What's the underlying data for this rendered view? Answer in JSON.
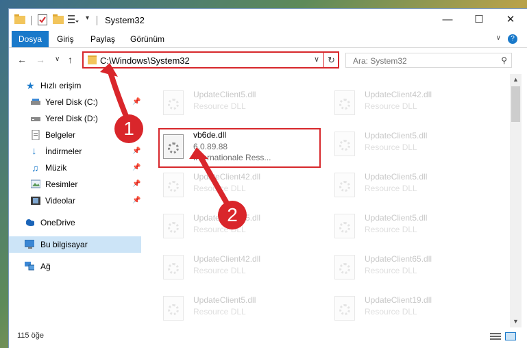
{
  "window": {
    "title": "System32"
  },
  "ribbon": {
    "tabs": [
      {
        "label": "Dosya",
        "active": true
      },
      {
        "label": "Giriş",
        "active": false
      },
      {
        "label": "Paylaş",
        "active": false
      },
      {
        "label": "Görünüm",
        "active": false
      }
    ],
    "help": "?"
  },
  "navigation": {
    "path": "C:\\Windows\\System32",
    "search_placeholder": "Ara: System32"
  },
  "sidebar": {
    "items": [
      {
        "label": "Hızlı erişim",
        "icon": "star-icon"
      },
      {
        "label": "Yerel Disk (C:)",
        "icon": "drive-icon",
        "pinned": true
      },
      {
        "label": "Yerel Disk (D:)",
        "icon": "drive-icon"
      },
      {
        "label": "Belgeler",
        "icon": "document-icon",
        "pinned": true
      },
      {
        "label": "İndirmeler",
        "icon": "download-icon",
        "pinned": true
      },
      {
        "label": "Müzik",
        "icon": "music-icon",
        "pinned": true
      },
      {
        "label": "Resimler",
        "icon": "pictures-icon",
        "pinned": true
      },
      {
        "label": "Videolar",
        "icon": "video-icon",
        "pinned": true
      },
      {
        "label": "OneDrive",
        "icon": "cloud-icon"
      },
      {
        "label": "Bu bilgisayar",
        "icon": "computer-icon",
        "selected": true
      },
      {
        "label": "Ağ",
        "icon": "network-icon"
      }
    ]
  },
  "files": {
    "highlighted": {
      "name": "vb6de.dll",
      "version": "6.0.89.88",
      "description": "Internationale Ress..."
    },
    "left_column": [
      {
        "name": "UpdateClient5.dll",
        "description": "Resource DLL"
      },
      {
        "name": "UpdateClient42.dll",
        "description": "Resource DLL"
      },
      {
        "name": "UpdateClient65.dll",
        "description": "Resource DLL"
      },
      {
        "name": "UpdateClient42.dll",
        "description": "Resource DLL"
      },
      {
        "name": "UpdateClient5.dll",
        "description": "Resource DLL"
      }
    ],
    "right_column": [
      {
        "name": "UpdateClient42.dll",
        "description": "Resource DLL"
      },
      {
        "name": "UpdateClient5.dll",
        "description": "Resource DLL"
      },
      {
        "name": "UpdateClient5.dll",
        "description": "Resource DLL"
      },
      {
        "name": "UpdateClient5.dll",
        "description": "Resource DLL"
      },
      {
        "name": "UpdateClient65.dll",
        "description": "Resource DLL"
      },
      {
        "name": "UpdateClient19.dll",
        "description": "Resource DLL"
      }
    ]
  },
  "status": {
    "item_count": "115 öğe"
  },
  "annotations": {
    "step1": "1",
    "step2": "2"
  },
  "colors": {
    "accent": "#1979ca",
    "highlight": "#d7272b",
    "selected": "#cce4f7"
  }
}
